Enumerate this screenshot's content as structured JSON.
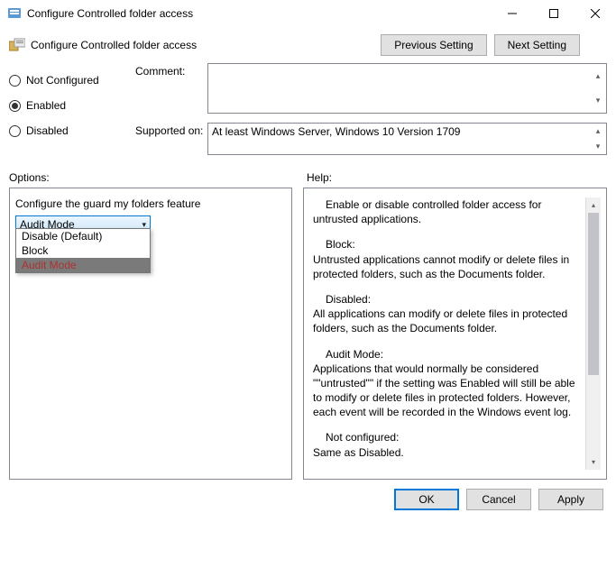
{
  "window": {
    "title": "Configure Controlled folder access"
  },
  "header": {
    "title": "Configure Controlled folder access",
    "prev": "Previous Setting",
    "next": "Next Setting"
  },
  "radios": {
    "not_configured": "Not Configured",
    "enabled": "Enabled",
    "disabled": "Disabled"
  },
  "fields": {
    "comment_label": "Comment:",
    "comment_value": "",
    "supported_label": "Supported on:",
    "supported_value": "At least Windows Server, Windows 10 Version 1709"
  },
  "sections": {
    "options": "Options:",
    "help": "Help:"
  },
  "options_panel": {
    "label": "Configure the guard my folders feature",
    "selected": "Audit Mode",
    "dropdown": [
      "Disable (Default)",
      "Block",
      "Audit Mode"
    ]
  },
  "help_text": {
    "p1": "Enable or disable controlled folder access for untrusted applications.",
    "h_block": "Block:",
    "p_block": "Untrusted applications cannot modify or delete files in protected folders, such as the Documents folder.",
    "h_disabled": "Disabled:",
    "p_disabled": "All applications can modify or delete files in protected folders, such as the Documents folder.",
    "h_audit": "Audit Mode:",
    "p_audit": "Applications that would normally be considered \"\"untrusted\"\" if the setting was Enabled will still be able to modify or delete files in protected folders. However, each event will be recorded in the Windows event log.",
    "h_nc": "Not configured:",
    "p_nc": "Same as Disabled."
  },
  "footer": {
    "ok": "OK",
    "cancel": "Cancel",
    "apply": "Apply"
  }
}
